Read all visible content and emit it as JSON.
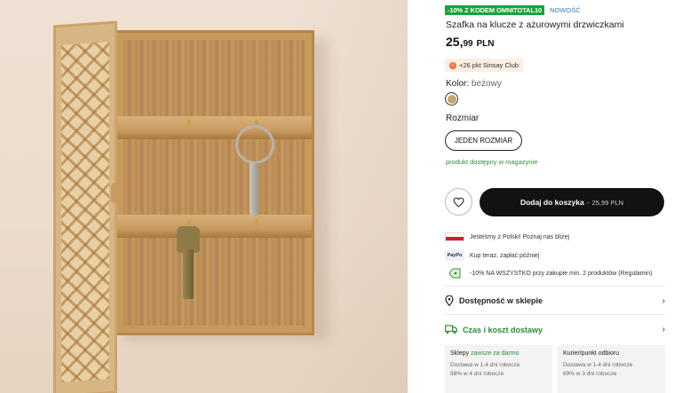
{
  "product": {
    "promo_badge": "-10% Z KODEM OMNITOTAL10",
    "new_badge": "NOWOŚĆ",
    "title": "Szafka na klucze z ażurowymi drzwiczkami",
    "price_main": "25,",
    "price_cents": "99",
    "price_currency": "PLN",
    "club_points": "+26 pkt Sinsay Club",
    "color_label": "Kolor:",
    "color_value": "beżowy",
    "swatch_color": "#c6a86a",
    "size_label": "Rozmiar",
    "size_button": "JEDEN ROZMIAR",
    "stock_status": "produkt dostępny w magazynie"
  },
  "actions": {
    "favorite_icon": "heart-icon",
    "add_to_cart_label": "Dodaj do koszyka",
    "add_to_cart_sep": "-",
    "add_to_cart_price": "25,99 PLN"
  },
  "features": [
    {
      "icon": "polish-flag",
      "text": "Jesteśmy z Polski! Poznaj nas bliżej"
    },
    {
      "icon": "paypo-logo",
      "text": "Kup teraz, zapłać później",
      "logo_text": "PayPo"
    },
    {
      "icon": "discount-tag-icon",
      "text": "-10% NA WSZYSTKO przy zakupie min. 2 produktów (Regulamin)"
    }
  ],
  "store_availability": {
    "label": "Dostępność w sklepie",
    "icon": "location-pin-icon"
  },
  "delivery": {
    "label": "Czas i koszt dostawy",
    "icon": "truck-icon",
    "options": [
      {
        "title": "Sklepy",
        "highlight": "zawsze za darmo",
        "line1": "Dostawa w 1-4 dni robocze",
        "line2": "98% w 4 dni robocze"
      },
      {
        "title": "Kurier/punkt odbioru",
        "highlight": "",
        "line1": "Dostawa w 1-4 dni robocze",
        "line2": "69% w 3 dni robocze"
      }
    ]
  },
  "colors": {
    "promo_green": "#17a43a",
    "stock_green": "#2f8b3a",
    "button_dark": "#121212",
    "new_blue": "#2f7fb8"
  }
}
